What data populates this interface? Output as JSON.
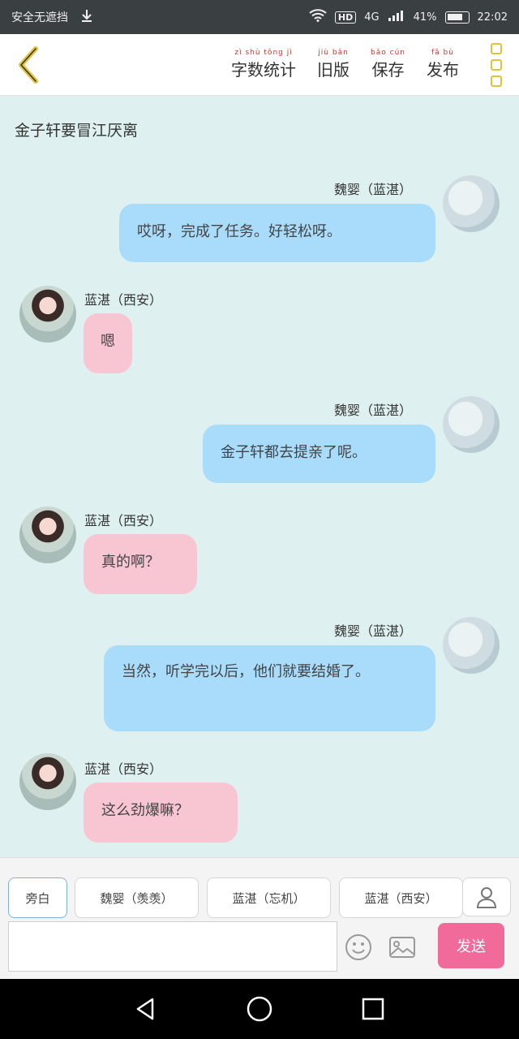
{
  "status_bar": {
    "left_text": "安全无遮挡",
    "network": "4G",
    "signal": "HD",
    "battery": "41%",
    "time": "22:02"
  },
  "toolbar": {
    "actions": [
      {
        "label": "字数统计",
        "pinyin": "zì shù tǒng jì"
      },
      {
        "label": "旧版",
        "pinyin": "jiù bǎn"
      },
      {
        "label": "保存",
        "pinyin": "bǎo cún"
      },
      {
        "label": "发布",
        "pinyin": "fā bù"
      }
    ]
  },
  "chat": {
    "title": "金子轩要冒江厌离",
    "messages": [
      {
        "side": "right",
        "sender": "魏婴（蓝湛）",
        "text": "哎呀，完成了任务。好轻松呀。"
      },
      {
        "side": "left",
        "sender": "蓝湛（西安）",
        "text": "嗯"
      },
      {
        "side": "right",
        "sender": "魏婴（蓝湛）",
        "text": "金子轩都去提亲了呢。"
      },
      {
        "side": "left",
        "sender": "蓝湛（西安）",
        "text": "真的啊？"
      },
      {
        "side": "right",
        "sender": "魏婴（蓝湛）",
        "text": "当然，听学完以后，他们就要结婚了。"
      },
      {
        "side": "left",
        "sender": "蓝湛（西安）",
        "text": "这么劲爆嘛？"
      }
    ]
  },
  "composer": {
    "roles": [
      "旁白",
      "魏婴（羡羡）",
      "蓝湛（忘机）",
      "蓝湛（西安）"
    ],
    "input_placeholder": "",
    "send_label": "发送"
  },
  "colors": {
    "bubble_right": "#a8dcfa",
    "bubble_left": "#f8c6d3",
    "send_button": "#f06b9a",
    "chat_background": "#dff0f0"
  }
}
